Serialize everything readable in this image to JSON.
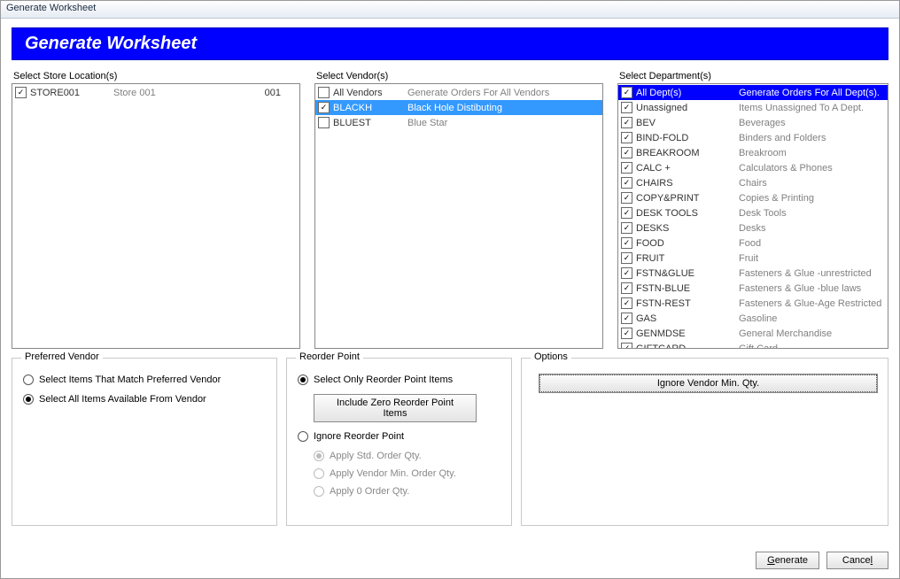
{
  "window": {
    "title": "Generate Worksheet"
  },
  "banner": {
    "title": "Generate Worksheet"
  },
  "stores": {
    "label": "Select Store Location(s)",
    "items": [
      {
        "checked": true,
        "code": "STORE001",
        "desc": "Store 001",
        "num": "001"
      }
    ]
  },
  "vendors": {
    "label": "Select Vendor(s)",
    "items": [
      {
        "checked": false,
        "code": "All Vendors",
        "desc": "Generate Orders For All Vendors",
        "sel": false,
        "header": true
      },
      {
        "checked": true,
        "code": "BLACKH",
        "desc": "Black Hole Distibuting",
        "sel": true
      },
      {
        "checked": false,
        "code": "BLUEST",
        "desc": "Blue Star",
        "sel": false
      }
    ]
  },
  "departments": {
    "label": "Select Department(s)",
    "items": [
      {
        "checked": true,
        "code": "All Dept(s)",
        "desc": "Generate Orders For All Dept(s).",
        "header": true
      },
      {
        "checked": true,
        "code": "Unassigned",
        "desc": "Items Unassigned To A Dept."
      },
      {
        "checked": true,
        "code": "BEV",
        "desc": "Beverages"
      },
      {
        "checked": true,
        "code": "BIND-FOLD",
        "desc": "Binders and Folders"
      },
      {
        "checked": true,
        "code": "BREAKROOM",
        "desc": "Breakroom"
      },
      {
        "checked": true,
        "code": "CALC +",
        "desc": "Calculators & Phones"
      },
      {
        "checked": true,
        "code": "CHAIRS",
        "desc": "Chairs"
      },
      {
        "checked": true,
        "code": "COPY&PRINT",
        "desc": "Copies & Printing"
      },
      {
        "checked": true,
        "code": "DESK TOOLS",
        "desc": "Desk Tools"
      },
      {
        "checked": true,
        "code": "DESKS",
        "desc": "Desks"
      },
      {
        "checked": true,
        "code": "FOOD",
        "desc": "Food"
      },
      {
        "checked": true,
        "code": "FRUIT",
        "desc": "Fruit"
      },
      {
        "checked": true,
        "code": "FSTN&GLUE",
        "desc": "Fasteners & Glue  -unrestricted"
      },
      {
        "checked": true,
        "code": "FSTN-BLUE",
        "desc": "Fasteners & Glue -blue laws"
      },
      {
        "checked": true,
        "code": "FSTN-REST",
        "desc": "Fasteners & Glue-Age Restricted"
      },
      {
        "checked": true,
        "code": "GAS",
        "desc": "Gasoline"
      },
      {
        "checked": true,
        "code": "GENMDSE",
        "desc": "General Merchandise"
      },
      {
        "checked": true,
        "code": "GIFTCARD",
        "desc": "Gift Card"
      }
    ]
  },
  "preferredVendor": {
    "legend": "Preferred Vendor",
    "options": {
      "matchPreferred": "Select Items That Match Preferred Vendor",
      "allAvailable": "Select All Items Available From Vendor"
    },
    "selected": "allAvailable"
  },
  "reorderPoint": {
    "legend": "Reorder Point",
    "options": {
      "selectOnly": "Select Only Reorder Point Items",
      "ignore": "Ignore Reorder Point"
    },
    "includeZeroBtn": "Include Zero Reorder Point Items",
    "subOptions": {
      "applyStd": "Apply Std. Order Qty.",
      "applyVendorMin": "Apply Vendor Min. Order Qty.",
      "applyZero": "Apply 0 Order Qty."
    },
    "selected": "selectOnly",
    "subSelected": "applyStd"
  },
  "options": {
    "legend": "Options",
    "ignoreVendorMinBtn": "Ignore Vendor Min. Qty."
  },
  "footer": {
    "generate": "Generate",
    "cancel": "Cancel"
  }
}
